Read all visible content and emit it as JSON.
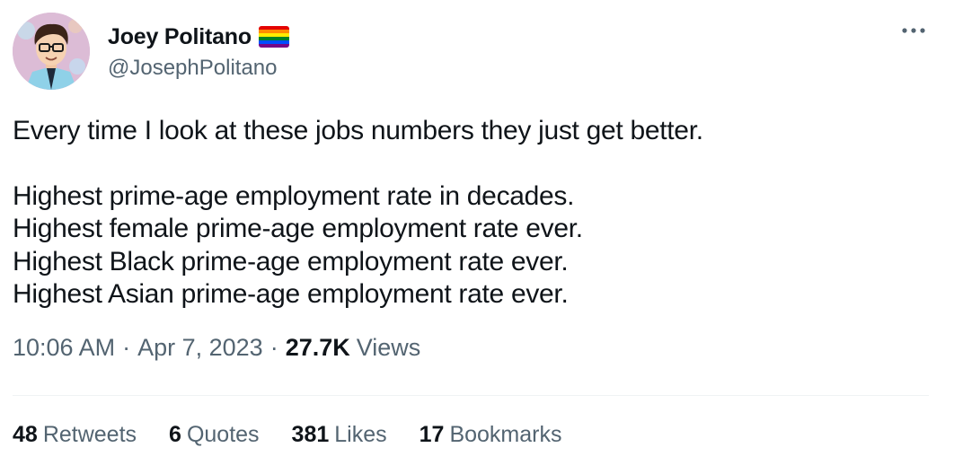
{
  "author": {
    "display_name": "Joey Politano",
    "handle": "@JosephPolitano",
    "badge_icon": "rainbow-flag-icon"
  },
  "tweet": {
    "lines": [
      "Every time I look at these jobs numbers they just get better.",
      "Highest prime-age employment rate in decades.",
      "Highest female prime-age employment rate ever.",
      "Highest Black prime-age employment rate ever.",
      "Highest Asian prime-age employment rate ever."
    ]
  },
  "meta": {
    "time": "10:06 AM",
    "separator": "·",
    "date": "Apr 7, 2023",
    "views_count": "27.7K",
    "views_label": "Views"
  },
  "stats": [
    {
      "count": "48",
      "label": "Retweets"
    },
    {
      "count": "6",
      "label": "Quotes"
    },
    {
      "count": "381",
      "label": "Likes"
    },
    {
      "count": "17",
      "label": "Bookmarks"
    }
  ],
  "colors": {
    "text_primary": "#0f1419",
    "text_secondary": "#536471",
    "divider": "#eff3f4"
  }
}
